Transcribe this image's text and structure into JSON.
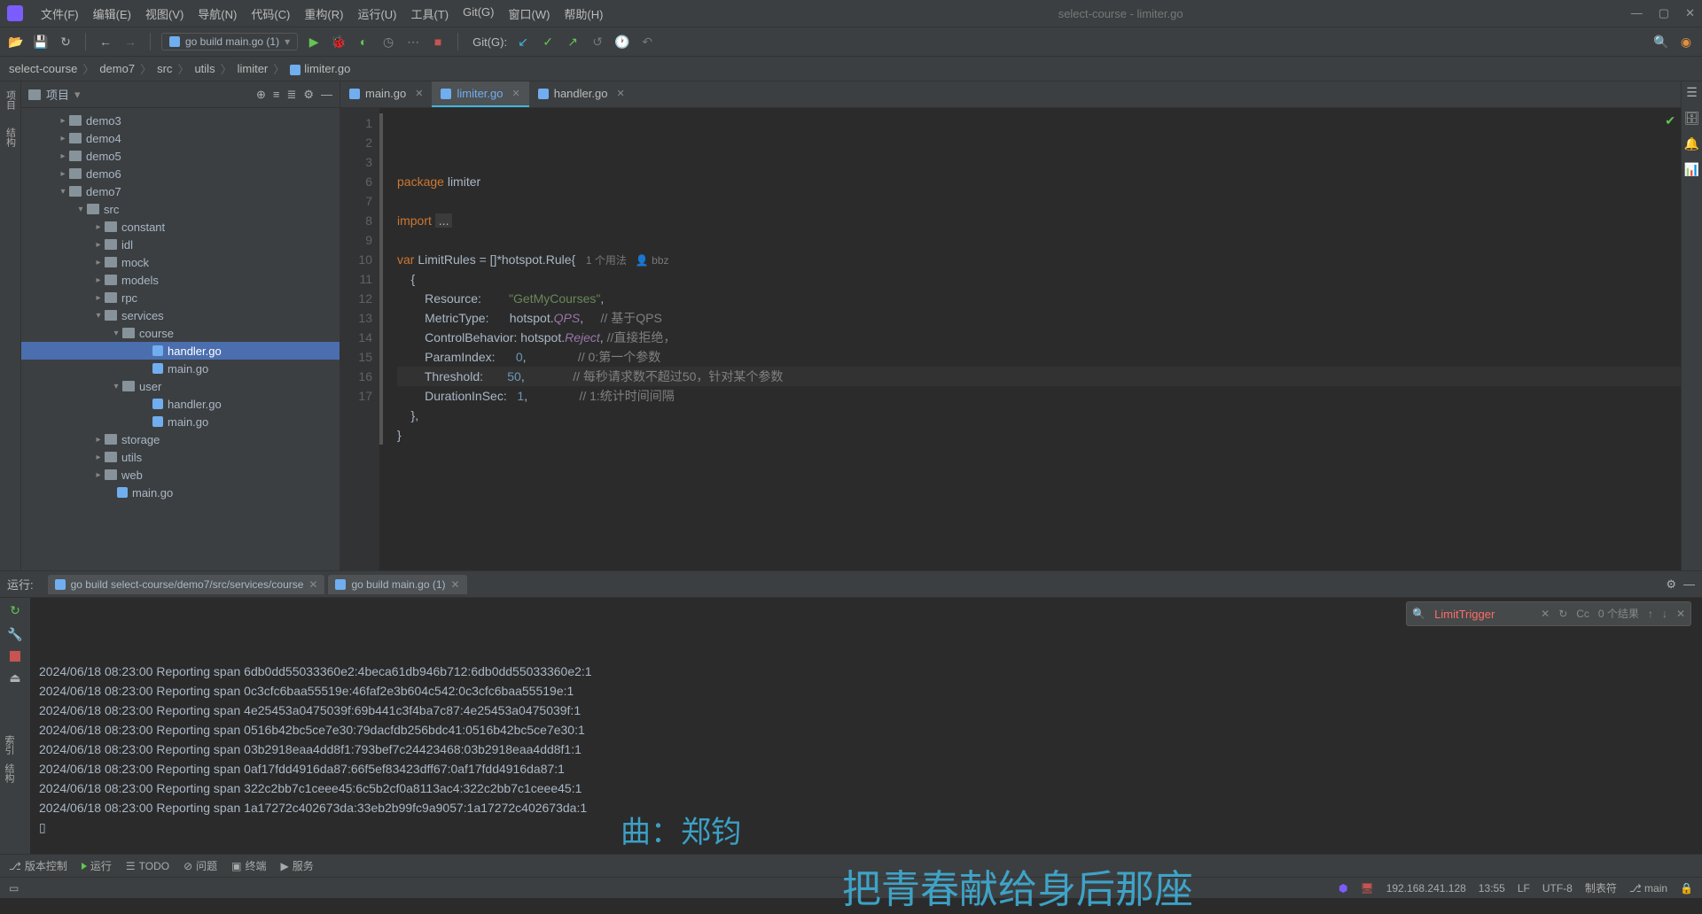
{
  "window": {
    "title": "select-course - limiter.go"
  },
  "menu": [
    "文件(F)",
    "编辑(E)",
    "视图(V)",
    "导航(N)",
    "代码(C)",
    "重构(R)",
    "运行(U)",
    "工具(T)",
    "Git(G)",
    "窗口(W)",
    "帮助(H)"
  ],
  "toolbar": {
    "run_config": "go build main.go (1)",
    "git_label": "Git(G):"
  },
  "breadcrumb": [
    "select-course",
    "demo7",
    "src",
    "utils",
    "limiter",
    "limiter.go"
  ],
  "project": {
    "title": "项目",
    "tree": [
      {
        "indent": 40,
        "arrow": "▸",
        "type": "folder",
        "name": "demo3"
      },
      {
        "indent": 40,
        "arrow": "▸",
        "type": "folder",
        "name": "demo4"
      },
      {
        "indent": 40,
        "arrow": "▸",
        "type": "folder",
        "name": "demo5"
      },
      {
        "indent": 40,
        "arrow": "▸",
        "type": "folder",
        "name": "demo6"
      },
      {
        "indent": 40,
        "arrow": "▾",
        "type": "folder",
        "name": "demo7"
      },
      {
        "indent": 60,
        "arrow": "▾",
        "type": "folder",
        "name": "src"
      },
      {
        "indent": 80,
        "arrow": "▸",
        "type": "folder",
        "name": "constant"
      },
      {
        "indent": 80,
        "arrow": "▸",
        "type": "folder",
        "name": "idl"
      },
      {
        "indent": 80,
        "arrow": "▸",
        "type": "folder",
        "name": "mock"
      },
      {
        "indent": 80,
        "arrow": "▸",
        "type": "folder",
        "name": "models"
      },
      {
        "indent": 80,
        "arrow": "▸",
        "type": "folder",
        "name": "rpc"
      },
      {
        "indent": 80,
        "arrow": "▾",
        "type": "folder",
        "name": "services"
      },
      {
        "indent": 100,
        "arrow": "▾",
        "type": "folder",
        "name": "course"
      },
      {
        "indent": 134,
        "arrow": "",
        "type": "go",
        "name": "handler.go",
        "selected": true
      },
      {
        "indent": 134,
        "arrow": "",
        "type": "go",
        "name": "main.go"
      },
      {
        "indent": 100,
        "arrow": "▾",
        "type": "folder",
        "name": "user"
      },
      {
        "indent": 134,
        "arrow": "",
        "type": "go",
        "name": "handler.go"
      },
      {
        "indent": 134,
        "arrow": "",
        "type": "go",
        "name": "main.go"
      },
      {
        "indent": 80,
        "arrow": "▸",
        "type": "folder",
        "name": "storage"
      },
      {
        "indent": 80,
        "arrow": "▸",
        "type": "folder",
        "name": "utils"
      },
      {
        "indent": 80,
        "arrow": "▸",
        "type": "folder",
        "name": "web"
      },
      {
        "indent": 94,
        "arrow": "",
        "type": "go",
        "name": "main.go"
      }
    ]
  },
  "tabs": [
    {
      "name": "main.go",
      "active": false
    },
    {
      "name": "limiter.go",
      "active": true
    },
    {
      "name": "handler.go",
      "active": false
    }
  ],
  "code": {
    "lines": [
      {
        "n": 1,
        "html": "<span class='kw'>package</span> <span class='typ'>limiter</span>"
      },
      {
        "n": 2,
        "html": ""
      },
      {
        "n": 3,
        "html": "<span class='kw'>import</span> <span class='op' style='background:#3b3b3b;padding:0 4px;'>...</span>"
      },
      {
        "n": 6,
        "html": ""
      },
      {
        "n": 7,
        "html": "<span class='kw'>var</span> <span class='typ'>LimitRules</span> = []*hotspot.<span class='typ'>Rule</span>{   <span class='hint'>1 个用法   👤 bbz</span>"
      },
      {
        "n": 8,
        "html": "    {"
      },
      {
        "n": 9,
        "html": "        Resource:        <span class='str'>\"GetMyCourses\"</span>,"
      },
      {
        "n": 10,
        "html": "        MetricType:      hotspot.<span class='fld'>QPS</span>,     <span class='cmt'>// 基于QPS</span>"
      },
      {
        "n": 11,
        "html": "        ControlBehavior: hotspot.<span class='fld'>Reject</span>, <span class='cmt'>//直接拒绝，</span>"
      },
      {
        "n": 12,
        "html": "        ParamIndex:      <span class='num'>0</span>,               <span class='cmt'>// 0:第一个参数</span>"
      },
      {
        "n": 13,
        "html": "        Threshold:       <span class='num'>50</span>,              <span class='cmt'>// 每秒请求数不超过50，针对某个参数</span>",
        "hl": true
      },
      {
        "n": 14,
        "html": "        DurationInSec:   <span class='num'>1</span>,               <span class='cmt'>// 1:统计时间间隔</span>"
      },
      {
        "n": 15,
        "html": "    },"
      },
      {
        "n": 16,
        "html": "}"
      },
      {
        "n": 17,
        "html": ""
      }
    ]
  },
  "run": {
    "label": "运行:",
    "tabs": [
      {
        "name": "go build select-course/demo7/src/services/course",
        "closable": true
      },
      {
        "name": "go build main.go (1)",
        "closable": true
      }
    ],
    "search_value": "LimitTrigger",
    "search_result": "0 个结果",
    "cc": "Cc",
    "lines": [
      "2024/06/18 08:23:00 Reporting span 6db0dd55033360e2:4beca61db946b712:6db0dd55033360e2:1",
      "2024/06/18 08:23:00 Reporting span 0c3cfc6baa55519e:46faf2e3b604c542:0c3cfc6baa55519e:1",
      "2024/06/18 08:23:00 Reporting span 4e25453a0475039f:69b441c3f4ba7c87:4e25453a0475039f:1",
      "2024/06/18 08:23:00 Reporting span 0516b42bc5ce7e30:79dacfdb256bdc41:0516b42bc5ce7e30:1",
      "2024/06/18 08:23:00 Reporting span 03b2918eaa4dd8f1:793bef7c24423468:03b2918eaa4dd8f1:1",
      "2024/06/18 08:23:00 Reporting span 0af17fdd4916da87:66f5ef83423dff67:0af17fdd4916da87:1",
      "2024/06/18 08:23:00 Reporting span 322c2bb7c1ceee45:6c5b2cf0a8113ac4:322c2bb7c1ceee45:1",
      "2024/06/18 08:23:00 Reporting span 1a17272c402673da:33eb2b99fc9a9057:1a17272c402673da:1",
      "▯"
    ]
  },
  "bottom": {
    "items": [
      "版本控制",
      "运行",
      "TODO",
      "问题",
      "终端",
      "服务"
    ]
  },
  "status": {
    "ip": "192.168.241.128",
    "time": "13:55",
    "lf": "LF",
    "enc": "UTF-8",
    "spaces": "制表符",
    "branch": "main"
  },
  "left_vtabs": [
    "项目",
    "结构"
  ],
  "left_index": [
    "索引",
    "结构"
  ],
  "overlay1": "曲：郑钧",
  "overlay2": "把青春献给身后那座"
}
